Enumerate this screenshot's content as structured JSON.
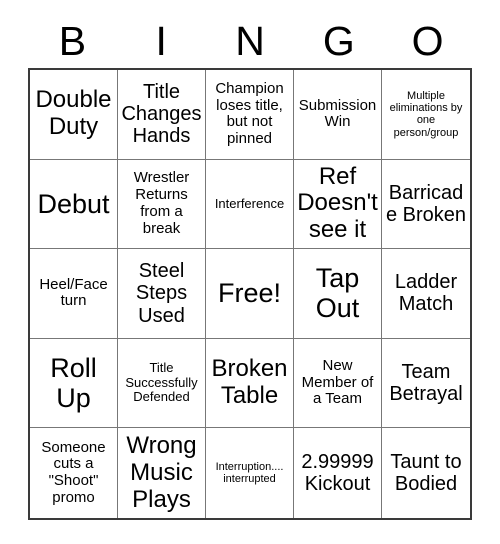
{
  "card": {
    "header_letters": [
      "B",
      "I",
      "N",
      "G",
      "O"
    ],
    "border_color": "#3a3a3a",
    "grid_line_color": "#777777",
    "background_color": "#ffffff",
    "text_color": "#000000",
    "rows": 5,
    "columns": 5,
    "cells": [
      {
        "text": "Double Duty",
        "size": "fs-lg"
      },
      {
        "text": "Title Changes Hands",
        "size": "fs-md"
      },
      {
        "text": "Champion loses title, but not pinned",
        "size": "fs-sm"
      },
      {
        "text": "Submission Win",
        "size": "fs-sm"
      },
      {
        "text": "Multiple eliminations by one person/group",
        "size": "fs-xxs"
      },
      {
        "text": "Debut",
        "size": "fs-xl"
      },
      {
        "text": "Wrestler Returns from a break",
        "size": "fs-sm"
      },
      {
        "text": "Interference",
        "size": "fs-xs"
      },
      {
        "text": "Ref Doesn't see it",
        "size": "fs-lg"
      },
      {
        "text": "Barricade Broken",
        "size": "fs-md"
      },
      {
        "text": "Heel/Face turn",
        "size": "fs-sm"
      },
      {
        "text": "Steel Steps Used",
        "size": "fs-md"
      },
      {
        "text": "Free!",
        "size": "fs-xl"
      },
      {
        "text": "Tap Out",
        "size": "fs-xl"
      },
      {
        "text": "Ladder Match",
        "size": "fs-md"
      },
      {
        "text": "Roll Up",
        "size": "fs-xl"
      },
      {
        "text": "Title Successfully Defended",
        "size": "fs-xs"
      },
      {
        "text": "Broken Table",
        "size": "fs-lg"
      },
      {
        "text": "New Member of a Team",
        "size": "fs-sm"
      },
      {
        "text": "Team Betrayal",
        "size": "fs-md"
      },
      {
        "text": "Someone cuts a \"Shoot\" promo",
        "size": "fs-sm"
      },
      {
        "text": "Wrong Music Plays",
        "size": "fs-lg"
      },
      {
        "text": "Interruption.... interrupted",
        "size": "fs-xxs"
      },
      {
        "text": "2.99999 Kickout",
        "size": "fs-md"
      },
      {
        "text": "Taunt to Bodied",
        "size": "fs-md"
      }
    ]
  }
}
